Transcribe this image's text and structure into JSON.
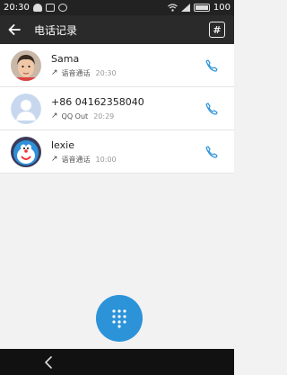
{
  "status_bar": {
    "time": "20:30",
    "battery": "100"
  },
  "app_bar": {
    "title": "电话记录",
    "dialpad_icon": "#"
  },
  "call_log": [
    {
      "name": "Sama",
      "type": "语音通话",
      "time": "20:30",
      "direction_icon": "↗",
      "avatar": "boy-photo"
    },
    {
      "name": "+86 04162358040",
      "type": "QQ Out",
      "time": "20:29",
      "direction_icon": "↗",
      "avatar": "default-person"
    },
    {
      "name": "lexie",
      "type": "语音通话",
      "time": "10:00",
      "direction_icon": "↗",
      "avatar": "doraemon"
    }
  ],
  "colors": {
    "accent": "#2d93d8",
    "appbar": "#2a2a2a",
    "statusbar": "#222222"
  }
}
